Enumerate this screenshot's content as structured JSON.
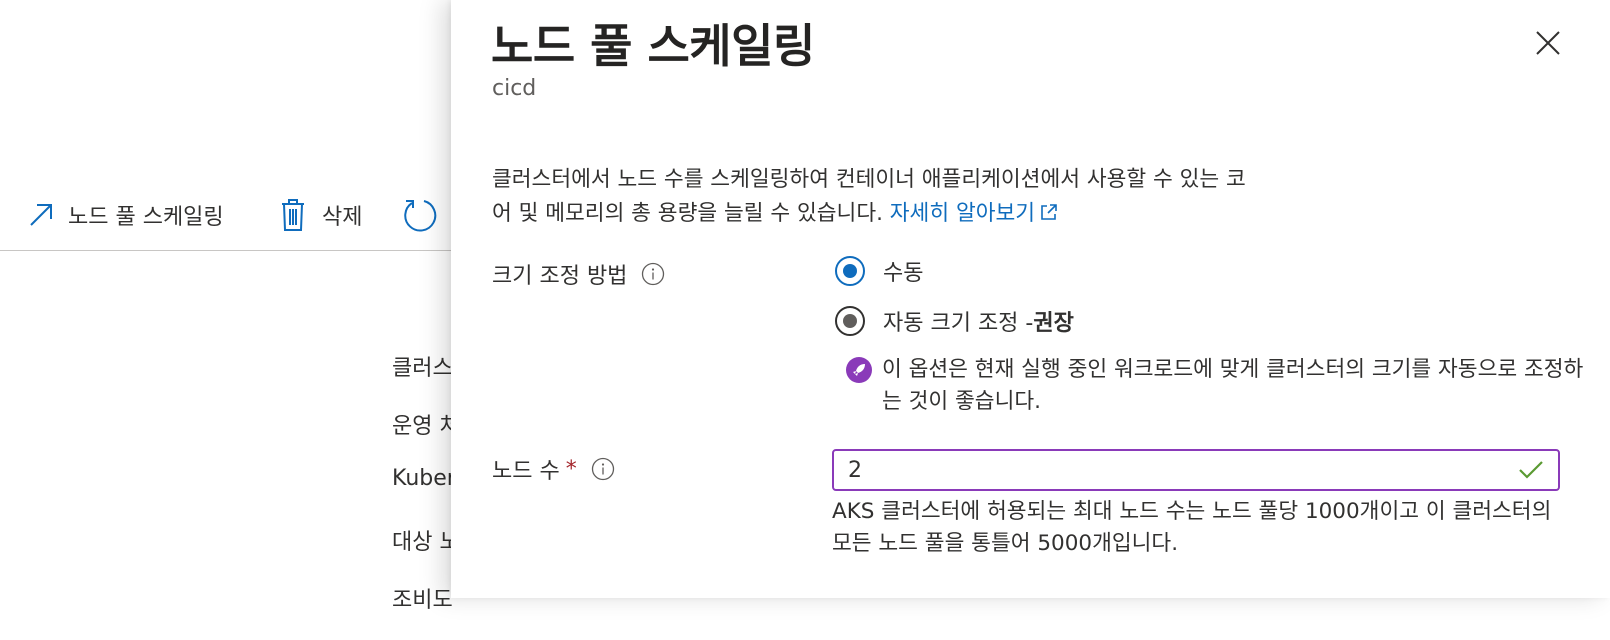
{
  "background": {
    "toolbar": {
      "scale_label": "노드 풀 스케일링",
      "delete_label": "삭제"
    },
    "list_items": [
      "클러스",
      "운영 처",
      "Kuber",
      "대상 노",
      "조비도"
    ]
  },
  "panel": {
    "title": "노드 풀 스케일링",
    "subtitle": "cicd",
    "description": "클러스터에서 노드 수를 스케일링하여 컨테이너 애플리케이션에서 사용할 수 있는 코어 및 메모리의 총 용량을 늘릴 수 있습니다.",
    "learn_more": "자세히 알아보기",
    "scale_method": {
      "label": "크기 조정 방법",
      "options": [
        {
          "label": "수동",
          "selected": true
        },
        {
          "label_prefix": "자동 크기 조정 - ",
          "label_bold": "권장",
          "selected": false
        }
      ],
      "hint": "이 옵션은 현재 실행 중인 워크로드에 맞게 클러스터의 크기를 자동으로 조정하는 것이 좋습니다."
    },
    "node_count": {
      "label": "노드 수",
      "required_mark": "*",
      "value": "2",
      "help": "AKS 클러스터에 허용되는 최대 노드 수는 노드 풀당 1000개이고 이 클러스터의 모든 노드 풀을 통틀어 5000개입니다."
    }
  },
  "colors": {
    "accent": "#0f6cbd",
    "input_border": "#8a3ab9",
    "valid_check": "#5a9a32",
    "required": "#a4262c"
  }
}
